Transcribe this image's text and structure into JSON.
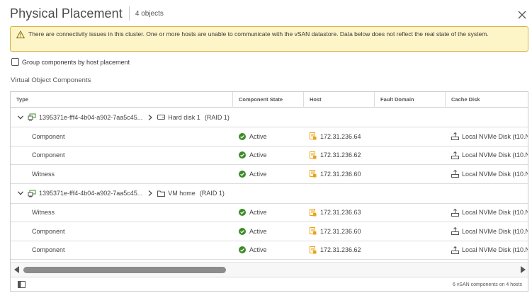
{
  "dialog": {
    "title": "Physical Placement",
    "subtitle": "4 objects",
    "close_icon": "close-icon"
  },
  "alert": {
    "icon": "warning-icon",
    "text": "There are connectivity issues in this cluster. One or more hosts are unable to communicate with the vSAN datastore. Data below does not reflect the real state of the system."
  },
  "group_toggle": {
    "label": "Group components by host placement",
    "checked": false
  },
  "section_title": "Virtual Object Components",
  "columns": [
    "Type",
    "Component State",
    "Host",
    "Fault Domain",
    "Cache Disk"
  ],
  "groups": [
    {
      "object_id": "1395371e-fff4-4b04-a902-7aa5c45...",
      "child": "Hard disk 1",
      "child_icon": "disk-icon",
      "raid": "(RAID 1)",
      "rows": [
        {
          "type": "Component",
          "state": "Active",
          "host": "172.31.236.64",
          "fault_domain": "",
          "cache_disk": "Local NVMe Disk (t10.N"
        },
        {
          "type": "Component",
          "state": "Active",
          "host": "172.31.236.62",
          "fault_domain": "",
          "cache_disk": "Local NVMe Disk (t10.N"
        },
        {
          "type": "Witness",
          "state": "Active",
          "host": "172.31.236.60",
          "fault_domain": "",
          "cache_disk": "Local NVMe Disk (t10.N"
        }
      ]
    },
    {
      "object_id": "1395371e-fff4-4b04-a902-7aa5c45...",
      "child": "VM home",
      "child_icon": "folder-icon",
      "raid": "(RAID 1)",
      "rows": [
        {
          "type": "Witness",
          "state": "Active",
          "host": "172.31.236.63",
          "fault_domain": "",
          "cache_disk": "Local NVMe Disk (t10.N"
        },
        {
          "type": "Component",
          "state": "Active",
          "host": "172.31.236.60",
          "fault_domain": "",
          "cache_disk": "Local NVMe Disk (t10.N"
        },
        {
          "type": "Component",
          "state": "Active",
          "host": "172.31.236.62",
          "fault_domain": "",
          "cache_disk": "Local NVMe Disk (t10.N"
        }
      ]
    }
  ],
  "footer": {
    "text": "6 vSAN components on 4 hosts",
    "column_toggle_icon": "column-toggle-icon"
  },
  "colors": {
    "alert_bg": "#fdf4c7",
    "alert_border": "#d8b53e",
    "active_green": "#3c8c28",
    "host_orange": "#e8a317",
    "scroll_thumb": "#8c8c8c"
  }
}
